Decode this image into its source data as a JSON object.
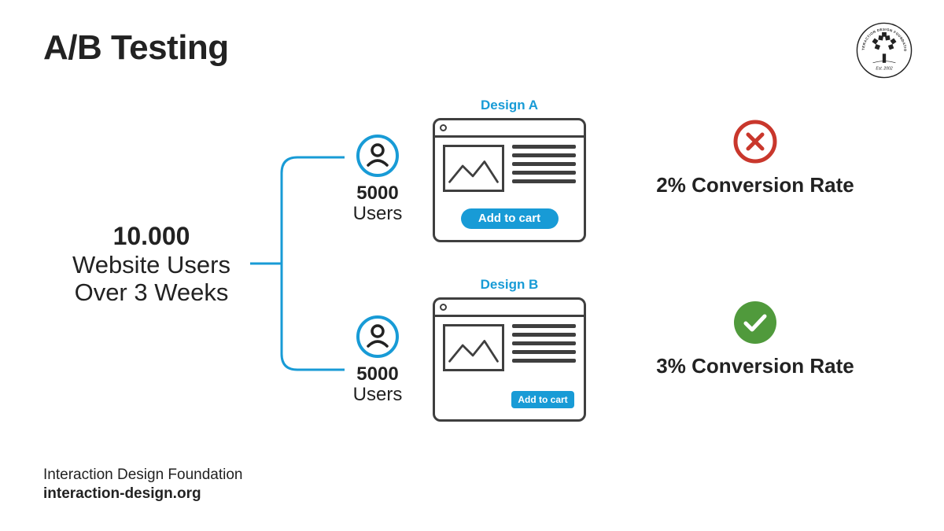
{
  "title": "A/B Testing",
  "logo": {
    "top": "INTERACTION DESIGN FOUNDATION",
    "est": "Est. 2002"
  },
  "left": {
    "line1_bold": "10.000",
    "line2": "Website Users",
    "line3": "Over 3 Weeks"
  },
  "groups": {
    "a": {
      "count": "5000",
      "label": "Users"
    },
    "b": {
      "count": "5000",
      "label": "Users"
    }
  },
  "designs": {
    "a": {
      "label": "Design A",
      "button": "Add to cart"
    },
    "b": {
      "label": "Design B",
      "button": "Add to cart"
    }
  },
  "results": {
    "a": {
      "rate": "2% Conversion Rate"
    },
    "b": {
      "rate": "3% Conversion Rate"
    }
  },
  "footer": {
    "org": "Interaction Design Foundation",
    "url": "interaction-design.org"
  },
  "colors": {
    "accent": "#189bd6",
    "fail": "#c9372c",
    "pass": "#509a3c"
  }
}
